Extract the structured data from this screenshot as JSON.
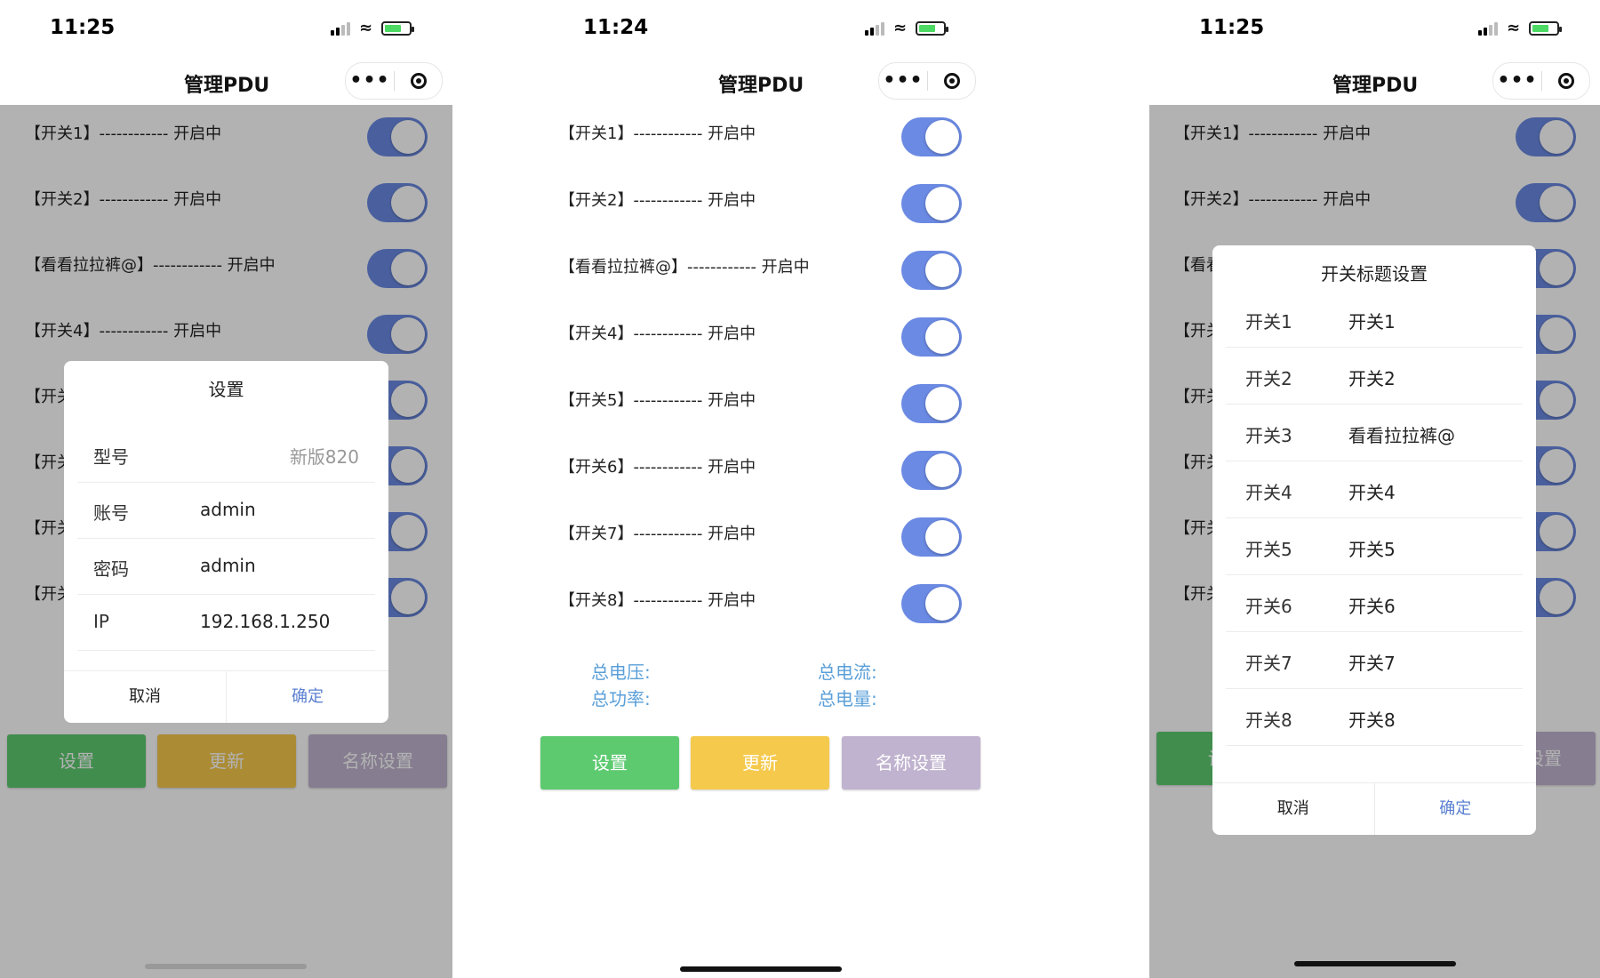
{
  "status": {
    "time1": "11:25",
    "time2": "11:24",
    "time3": "11:25"
  },
  "nav": {
    "title": "管理PDU",
    "more": "•••"
  },
  "switches": [
    {
      "label": "【开关1】------------ 开启中"
    },
    {
      "label": "【开关2】------------ 开启中"
    },
    {
      "label": "【看看拉拉裤@】------------ 开启中"
    },
    {
      "label": "【开关4】------------ 开启中"
    },
    {
      "label": "【开关5】------------ 开启中"
    },
    {
      "label": "【开关6】------------ 开启中"
    },
    {
      "label": "【开关7】------------ 开启中"
    },
    {
      "label": "【开关8】------------ 开启中"
    }
  ],
  "partial_labels": {
    "s1": [
      "【开关1】------------ 开启中",
      "【开关2】------------ 开启中",
      "【看看拉拉裤@】------------ 开启中",
      "【开关4】------------ 开启中",
      "【开关",
      "【开关",
      "【开关",
      "【开关"
    ],
    "s3": [
      "【开关1】------------ 开启中",
      "【开关2】------------ 开启中",
      "【看看",
      "【开关",
      "【开关",
      "【开关",
      "【开关",
      "【开关"
    ]
  },
  "stats": {
    "voltage": "总电压:",
    "current": "总电流:",
    "power": "总功率:",
    "energy": "总电量:"
  },
  "buttons": {
    "settings": "设置",
    "update": "更新",
    "rename": "名称设置"
  },
  "settings_modal": {
    "title": "设置",
    "model_label": "型号",
    "model_value": "新版820",
    "account_label": "账号",
    "account_value": "admin",
    "password_label": "密码",
    "password_value": "admin",
    "ip_label": "IP",
    "ip_value": "192.168.1.250",
    "cancel": "取消",
    "confirm": "确定"
  },
  "title_modal": {
    "title": "开关标题设置",
    "rows": [
      {
        "key": "开关1",
        "value": "开关1"
      },
      {
        "key": "开关2",
        "value": "开关2"
      },
      {
        "key": "开关3",
        "value": "看看拉拉裤@"
      },
      {
        "key": "开关4",
        "value": "开关4"
      },
      {
        "key": "开关5",
        "value": "开关5"
      },
      {
        "key": "开关6",
        "value": "开关6"
      },
      {
        "key": "开关7",
        "value": "开关7"
      },
      {
        "key": "开关8",
        "value": "开关8"
      }
    ],
    "cancel": "取消",
    "confirm": "确定"
  },
  "colors": {
    "toggle_on": "#6b8ae3",
    "green": "#5dca70",
    "yellow": "#f5c94c",
    "purple": "#c0b3cf",
    "stat_text": "#5a9fd8",
    "link": "#5a7fd0"
  }
}
